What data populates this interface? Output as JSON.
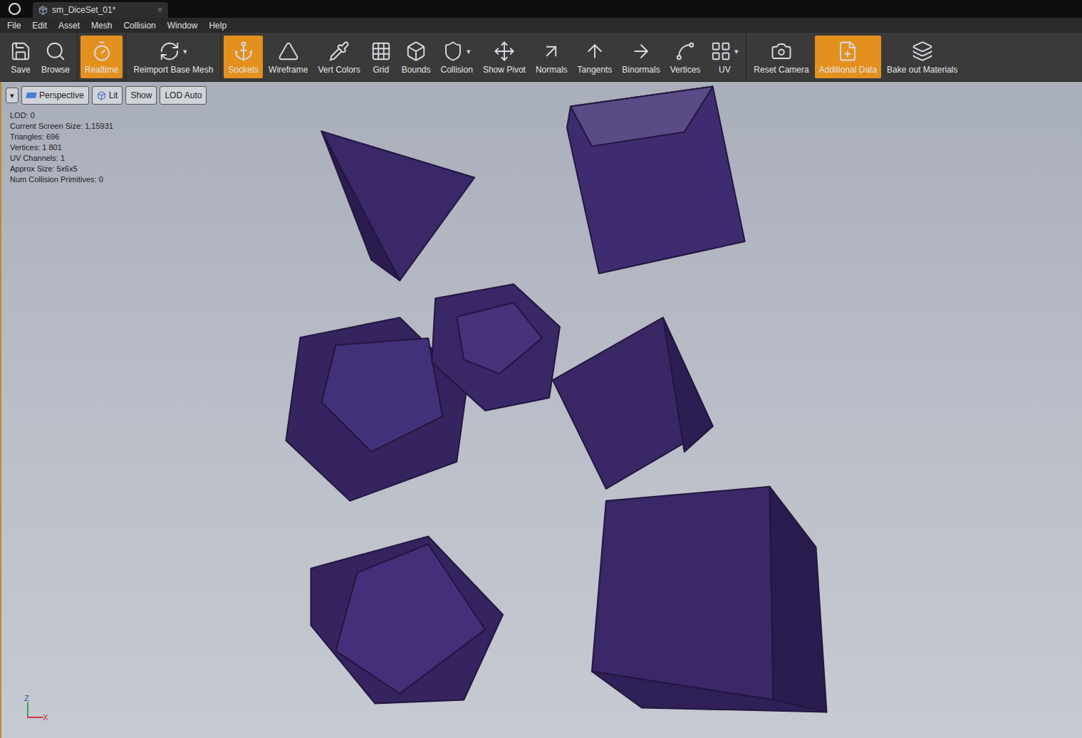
{
  "window": {
    "title": "sm_DiceSet_01*",
    "close": "×"
  },
  "menu": [
    "File",
    "Edit",
    "Asset",
    "Mesh",
    "Collision",
    "Window",
    "Help"
  ],
  "toolbar": {
    "dropdown_glyph": "▾",
    "groups": [
      [
        {
          "label": "Save",
          "selected": false,
          "dropdown": false
        },
        {
          "label": "Browse",
          "selected": false,
          "dropdown": false
        }
      ],
      [
        {
          "label": "Realtime",
          "selected": true,
          "dropdown": false
        }
      ],
      [
        {
          "label": "Reimport Base Mesh",
          "selected": false,
          "dropdown": true
        }
      ],
      [
        {
          "label": "Sockets",
          "selected": true,
          "dropdown": false
        },
        {
          "label": "Wireframe",
          "selected": false,
          "dropdown": false
        },
        {
          "label": "Vert Colors",
          "selected": false,
          "dropdown": false
        },
        {
          "label": "Grid",
          "selected": false,
          "dropdown": false
        },
        {
          "label": "Bounds",
          "selected": false,
          "dropdown": false
        },
        {
          "label": "Collision",
          "selected": false,
          "dropdown": true
        },
        {
          "label": "Show Pivot",
          "selected": false,
          "dropdown": false
        },
        {
          "label": "Normals",
          "selected": false,
          "dropdown": false
        },
        {
          "label": "Tangents",
          "selected": false,
          "dropdown": false
        },
        {
          "label": "Binormals",
          "selected": false,
          "dropdown": false
        },
        {
          "label": "Vertices",
          "selected": false,
          "dropdown": false
        },
        {
          "label": "UV",
          "selected": false,
          "dropdown": true
        }
      ],
      [
        {
          "label": "Reset Camera",
          "selected": false,
          "dropdown": false
        },
        {
          "label": "Additional Data",
          "selected": true,
          "dropdown": false
        },
        {
          "label": "Bake out Materials",
          "selected": false,
          "dropdown": false
        }
      ]
    ]
  },
  "viewport": {
    "menu_glyph": "▾",
    "buttons": [
      {
        "label": "Perspective"
      },
      {
        "label": "Lit"
      },
      {
        "label": "Show"
      },
      {
        "label": "LOD Auto"
      }
    ],
    "stats": [
      "LOD: 0",
      "Current Screen Size: 1,15931",
      "Triangles: 696",
      "Vertices: 1 801",
      "UV Channels: 1",
      "Approx Size: 5x6x5",
      "Num Collision Primitives: 0"
    ],
    "axes": {
      "z": "Z",
      "x": "X"
    }
  }
}
